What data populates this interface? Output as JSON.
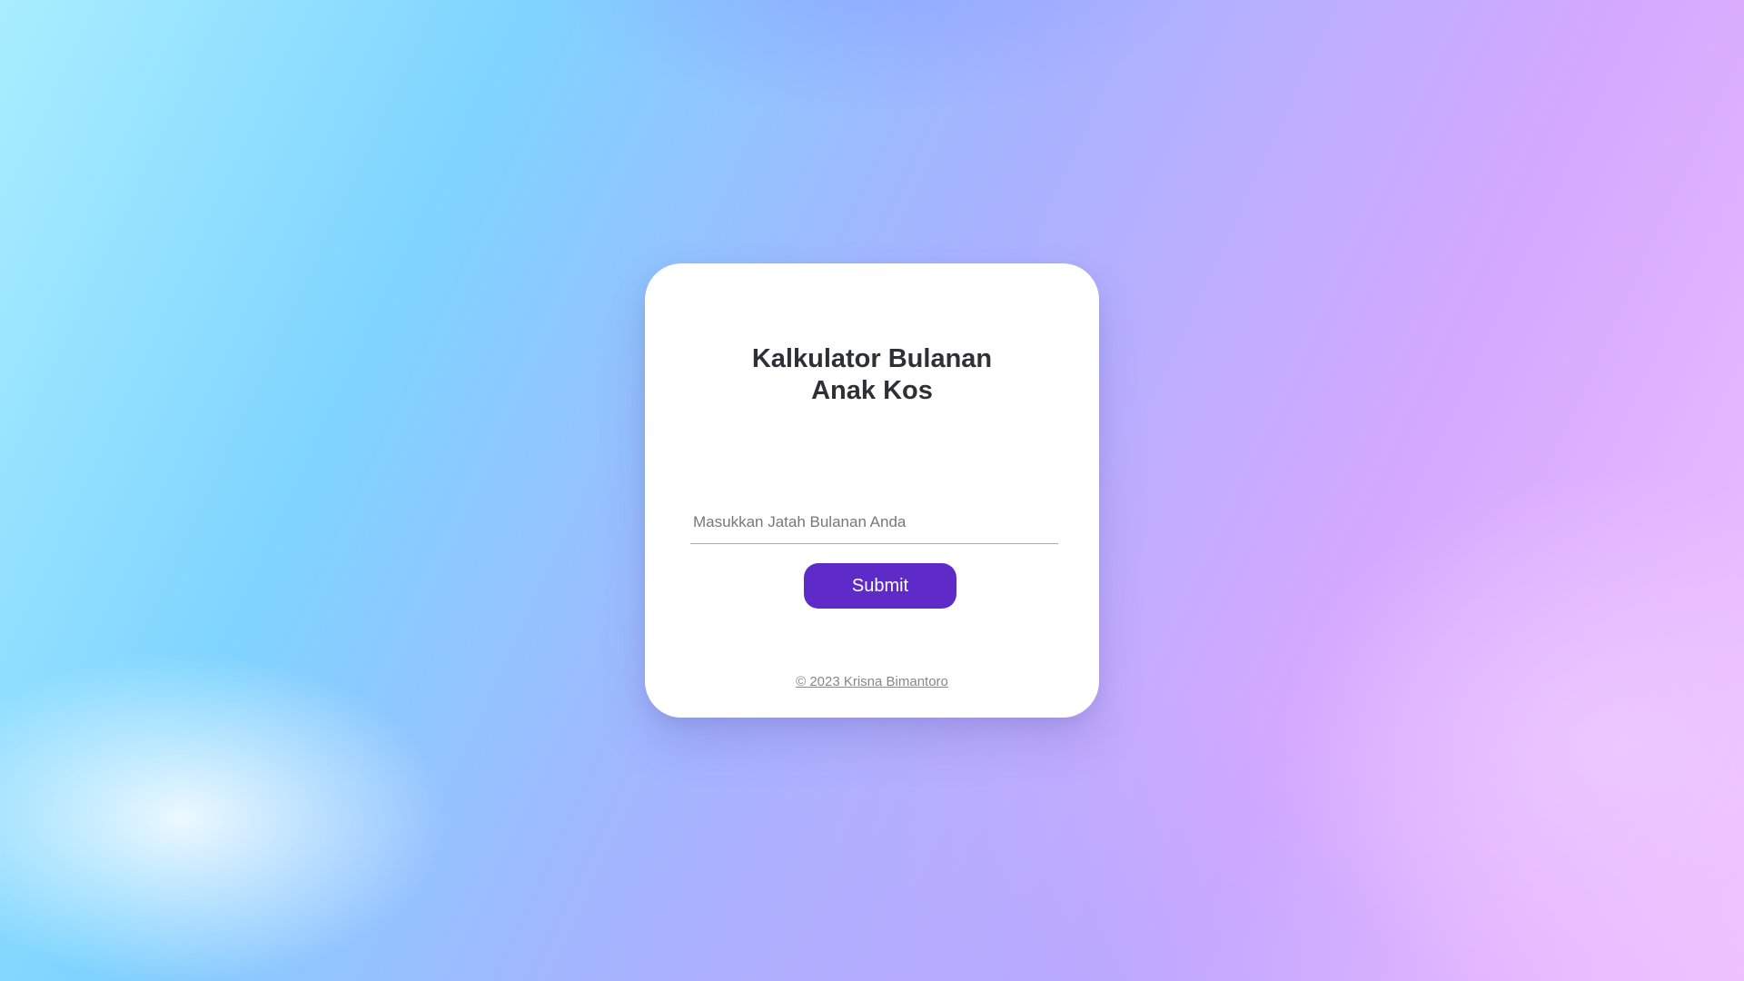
{
  "card": {
    "title_line_1": "Kalkulator Bulanan",
    "title_line_2": "Anak Kos",
    "input": {
      "value": "",
      "placeholder": "Masukkan Jatah Bulanan Anda"
    },
    "submit_label": "Submit",
    "footer_text": "© 2023 Krisna Bimantoro"
  },
  "colors": {
    "button": "#5e2bc9",
    "card_background": "#ffffff",
    "title_text": "#2f2f36"
  }
}
